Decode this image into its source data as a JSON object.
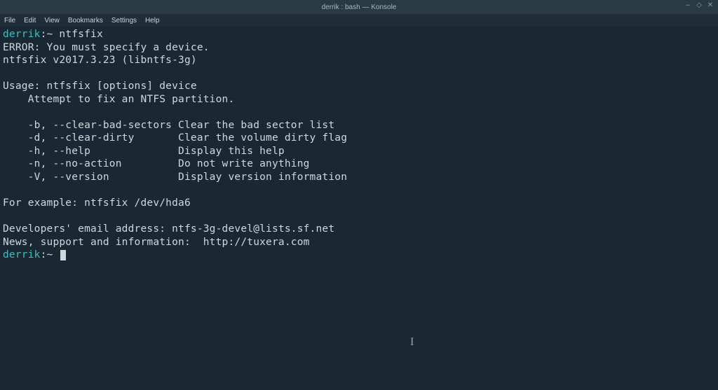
{
  "window": {
    "title": "derrik : bash — Konsole"
  },
  "menubar": {
    "items": [
      "File",
      "Edit",
      "View",
      "Bookmarks",
      "Settings",
      "Help"
    ]
  },
  "prompt": {
    "user": "derrik",
    "sep": ":",
    "path": "~",
    "symbol": " "
  },
  "lines": {
    "l0_cmd": "ntfsfix",
    "l1": "ERROR: You must specify a device.",
    "l2": "ntfsfix v2017.3.23 (libntfs-3g)",
    "l3": "",
    "l4": "Usage: ntfsfix [options] device",
    "l5": "    Attempt to fix an NTFS partition.",
    "l6": "",
    "l7": "    -b, --clear-bad-sectors Clear the bad sector list",
    "l8": "    -d, --clear-dirty       Clear the volume dirty flag",
    "l9": "    -h, --help              Display this help",
    "l10": "    -n, --no-action         Do not write anything",
    "l11": "    -V, --version           Display version information",
    "l12": "",
    "l13": "For example: ntfsfix /dev/hda6",
    "l14": "",
    "l15": "Developers' email address: ntfs-3g-devel@lists.sf.net",
    "l16": "News, support and information:  http://tuxera.com"
  },
  "window_controls": {
    "min": "‒",
    "max": "◇",
    "close": "✕"
  }
}
